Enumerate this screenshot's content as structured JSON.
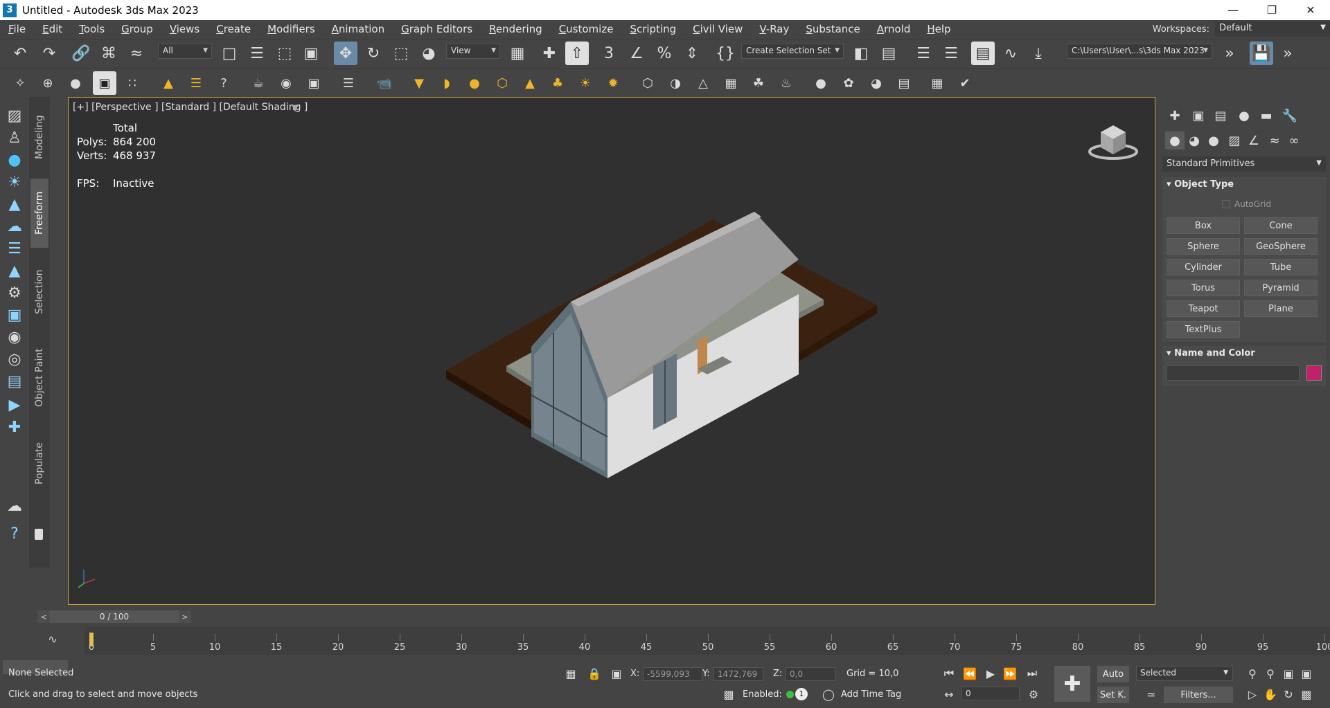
{
  "window": {
    "title": "Untitled - Autodesk 3ds Max 2023",
    "app_icon": "3"
  },
  "menu": [
    "File",
    "Edit",
    "Tools",
    "Group",
    "Views",
    "Create",
    "Modifiers",
    "Animation",
    "Graph Editors",
    "Rendering",
    "Customize",
    "Scripting",
    "Civil View",
    "V-Ray",
    "Substance",
    "Arnold",
    "Help"
  ],
  "workspace": {
    "label": "Workspaces:",
    "value": "Default"
  },
  "toolbar": {
    "selection_filter": "All",
    "ref_coord": "View",
    "selection_set": "Create Selection Set",
    "project_path": "C:\\Users\\User\\...s\\3ds Max 2023"
  },
  "ribbon_tabs": [
    "Modeling",
    "Freeform",
    "Selection",
    "Object Paint",
    "Populate"
  ],
  "viewport": {
    "label": "[+] [Perspective ] [Standard ] [Default Shading ]",
    "stats_header": "Total",
    "polys_label": "Polys:",
    "polys_value": "864 200",
    "verts_label": "Verts:",
    "verts_value": "468 937",
    "fps_label": "FPS:",
    "fps_value": "Inactive"
  },
  "command_panel": {
    "category": "Standard Primitives",
    "object_type_title": "Object Type",
    "autogrid_label": "AutoGrid",
    "primitives": [
      "Box",
      "Cone",
      "Sphere",
      "GeoSphere",
      "Cylinder",
      "Tube",
      "Torus",
      "Pyramid",
      "Teapot",
      "Plane",
      "TextPlus"
    ],
    "name_color_title": "Name and Color",
    "object_color": "#c2206a"
  },
  "time_slider": {
    "label": "0 / 100",
    "current_frame": 0,
    "total_frames": 100
  },
  "trackbar": {
    "ticks": [
      "0",
      "5",
      "10",
      "15",
      "20",
      "25",
      "30",
      "35",
      "40",
      "45",
      "50",
      "55",
      "60",
      "65",
      "70",
      "75",
      "80",
      "85",
      "90",
      "95",
      "100"
    ]
  },
  "status": {
    "selection": "None Selected",
    "prompt": "Click and drag to select and move objects",
    "x_label": "X:",
    "x_value": "-5599,093",
    "y_label": "Y:",
    "y_value": "1472,769",
    "z_label": "Z:",
    "z_value": "0,0",
    "grid": "Grid = 10,0",
    "enabled_label": "Enabled:",
    "enabled_count": "1",
    "add_time_tag": "Add Time Tag",
    "auto_key": "Auto",
    "set_key": "Set K.",
    "key_filter": "Selected",
    "filters": "Filters...",
    "frame_value": "0"
  }
}
